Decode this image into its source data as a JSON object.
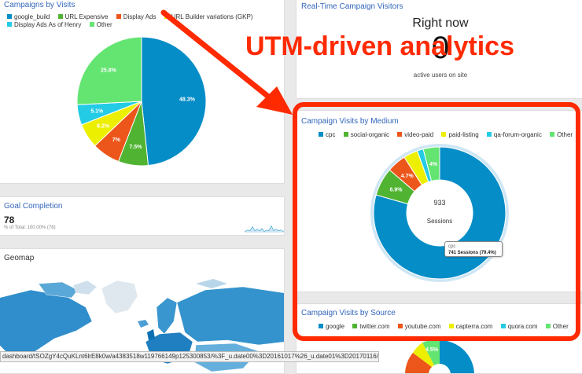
{
  "panels": {
    "campaigns_by_visits": {
      "title": "Campaigns by Visits",
      "legend": [
        {
          "label": "google_build",
          "color": "#058dc7"
        },
        {
          "label": "URL Expensive",
          "color": "#50b432"
        },
        {
          "label": "Display Ads",
          "color": "#ed561b"
        },
        {
          "label": "URL Builder variations (GKP)",
          "color": "#edef00"
        },
        {
          "label": "Display Ads As of Henry",
          "color": "#24cbe5"
        },
        {
          "label": "Other",
          "color": "#64e572"
        }
      ]
    },
    "realtime": {
      "title": "Real-Time Campaign Visitors",
      "right_now_label": "Right now",
      "active_count": "0",
      "active_label": "active users on site"
    },
    "goal_completion": {
      "title": "Goal Completion",
      "value": "78",
      "subtext": "% of Total: 100.00% (78)"
    },
    "geomap": {
      "title": "Geomap"
    },
    "by_medium": {
      "title": "Campaign Visits by Medium",
      "legend": [
        {
          "label": "cpc",
          "color": "#058dc7"
        },
        {
          "label": "social-organic",
          "color": "#50b432"
        },
        {
          "label": "video-paid",
          "color": "#ed561b"
        },
        {
          "label": "paid-listing",
          "color": "#edef00"
        },
        {
          "label": "qa-forum-organic",
          "color": "#24cbe5"
        },
        {
          "label": "Other",
          "color": "#64e572"
        }
      ],
      "center_value": "933",
      "center_label": "Sessions",
      "tooltip_title": "cpc",
      "tooltip_value": "741 Sessions (79.4%)"
    },
    "by_source": {
      "title": "Campaign Visits by Source",
      "legend": [
        {
          "label": "google",
          "color": "#058dc7"
        },
        {
          "label": "twitter.com",
          "color": "#50b432"
        },
        {
          "label": "youtube.com",
          "color": "#ed561b"
        },
        {
          "label": "capterra.com",
          "color": "#edef00"
        },
        {
          "label": "quora.com",
          "color": "#24cbe5"
        },
        {
          "label": "Other",
          "color": "#64e572"
        }
      ],
      "visible_label": "4.5%"
    }
  },
  "annotation": {
    "text": "UTM-driven analytics",
    "color": "#ff2a00"
  },
  "status_url": "dashboard/tSOZgY4cQuKLnt6lrE8k0w/a4383518w119766149p125300853/%3F_u.date00%3D20161017%26_u.date01%3D20170116/",
  "chart_data": [
    {
      "type": "pie",
      "categories": [
        "google_build",
        "URL Expensive",
        "Display Ads",
        "URL Builder variations (GKP)",
        "Display Ads As of Henry",
        "Other"
      ],
      "values": [
        48.3,
        7.5,
        7,
        6.2,
        5.1,
        25.8
      ],
      "colors": [
        "#058dc7",
        "#50b432",
        "#ed561b",
        "#edef00",
        "#24cbe5",
        "#64e572"
      ],
      "labels": [
        "48.3%",
        "7.5%",
        "7%",
        "6.2%",
        "5.1%",
        "25.8%"
      ]
    },
    {
      "type": "pie",
      "categories": [
        "cpc",
        "social-organic",
        "video-paid",
        "paid-listing",
        "qa-forum-organic",
        "Other"
      ],
      "values": [
        79.4,
        6.9,
        4.7,
        3.5,
        1.5,
        4
      ],
      "colors": [
        "#058dc7",
        "#50b432",
        "#ed561b",
        "#edef00",
        "#24cbe5",
        "#64e572"
      ],
      "labels": [
        "",
        "6.9%",
        "4.7%",
        "",
        "",
        "4%"
      ]
    }
  ]
}
